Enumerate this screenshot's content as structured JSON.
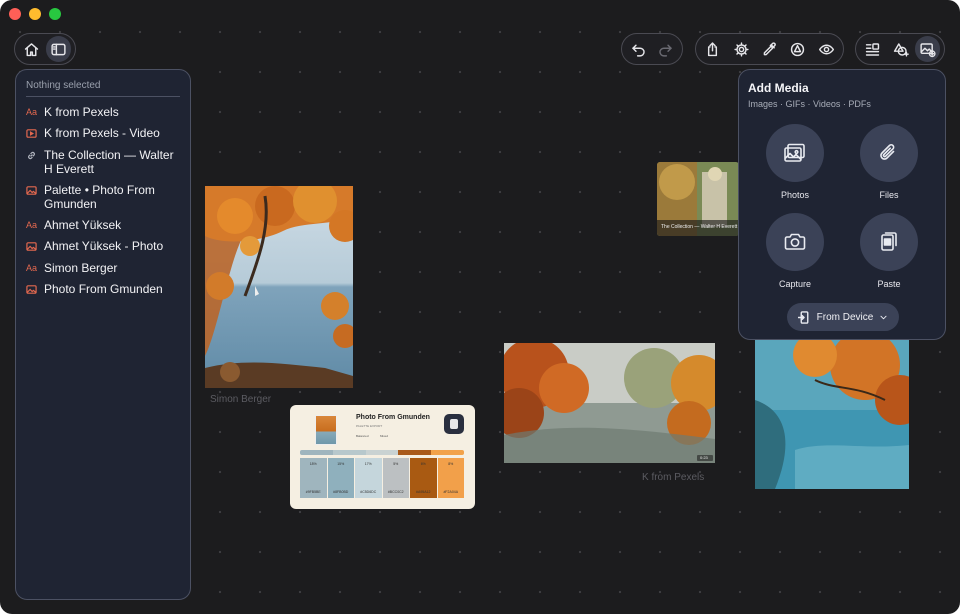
{
  "window": {
    "controls": [
      "close",
      "minimize",
      "zoom"
    ]
  },
  "toolbar": {
    "left": [
      {
        "name": "home-icon",
        "active": false
      },
      {
        "name": "sidebar-toggle-icon",
        "active": true
      }
    ],
    "history": [
      {
        "name": "undo-icon",
        "enabled": true
      },
      {
        "name": "redo-icon",
        "enabled": false
      }
    ],
    "tools": [
      "share-icon",
      "gear-icon",
      "eyedropper-icon",
      "shapes-icon",
      "eye-icon"
    ],
    "right": [
      {
        "name": "text-list-icon",
        "active": false
      },
      {
        "name": "add-shape-icon",
        "active": false
      },
      {
        "name": "add-media-icon",
        "active": true
      }
    ]
  },
  "sidebar": {
    "header": "Nothing selected",
    "items": [
      {
        "icon": "text-icon",
        "label": "K from Pexels"
      },
      {
        "icon": "video-icon",
        "label": "K from Pexels - Video"
      },
      {
        "icon": "link-icon",
        "label": "The Collection — Walter H Everett"
      },
      {
        "icon": "image-icon",
        "label": "Palette • Photo From Gmunden"
      },
      {
        "icon": "text-icon",
        "label": "Ahmet Yüksek"
      },
      {
        "icon": "image-icon",
        "label": "Ahmet Yüksek - Photo"
      },
      {
        "icon": "text-icon",
        "label": "Simon Berger"
      },
      {
        "icon": "image-icon",
        "label": "Photo From Gmunden"
      }
    ]
  },
  "canvas": {
    "captions": {
      "simon": "Simon Berger",
      "kpexels": "K from Pexels",
      "collection": "The Collection — Walter H Everett"
    },
    "video_badge": "0:23",
    "palette_card": {
      "title": "Photo From Gmunden",
      "subtitle": "PALETTE EXPORT",
      "meta_left": "Balanced",
      "meta_right": "Mixed",
      "bar_colors": [
        "#9fb5be",
        "#b7c8cc",
        "#c9d2d2",
        "#a95a1a",
        "#f2a24a"
      ],
      "swatches": [
        {
          "color": "#9fb5be",
          "pct": "18%",
          "hex": "#9FB5BE"
        },
        {
          "color": "#8fb0bd",
          "pct": "15%",
          "hex": "#8FB0BD"
        },
        {
          "color": "#c5d6dc",
          "pct": "17%",
          "hex": "#C5D6DC"
        },
        {
          "color": "#bcc0c2",
          "pct": "5%",
          "hex": "#BCC0C2"
        },
        {
          "color": "#a95a12",
          "pct": "6%",
          "hex": "#A95A12"
        },
        {
          "color": "#f2a04a",
          "pct": "8%",
          "hex": "#F2A04A"
        }
      ]
    }
  },
  "media_panel": {
    "title": "Add Media",
    "subtitle": "Images · GIFs · Videos · PDFs",
    "options": [
      {
        "icon": "photos-icon",
        "label": "Photos"
      },
      {
        "icon": "paperclip-icon",
        "label": "Files"
      },
      {
        "icon": "camera-icon",
        "label": "Capture"
      },
      {
        "icon": "paste-icon",
        "label": "Paste"
      }
    ],
    "device_button": "From Device"
  }
}
